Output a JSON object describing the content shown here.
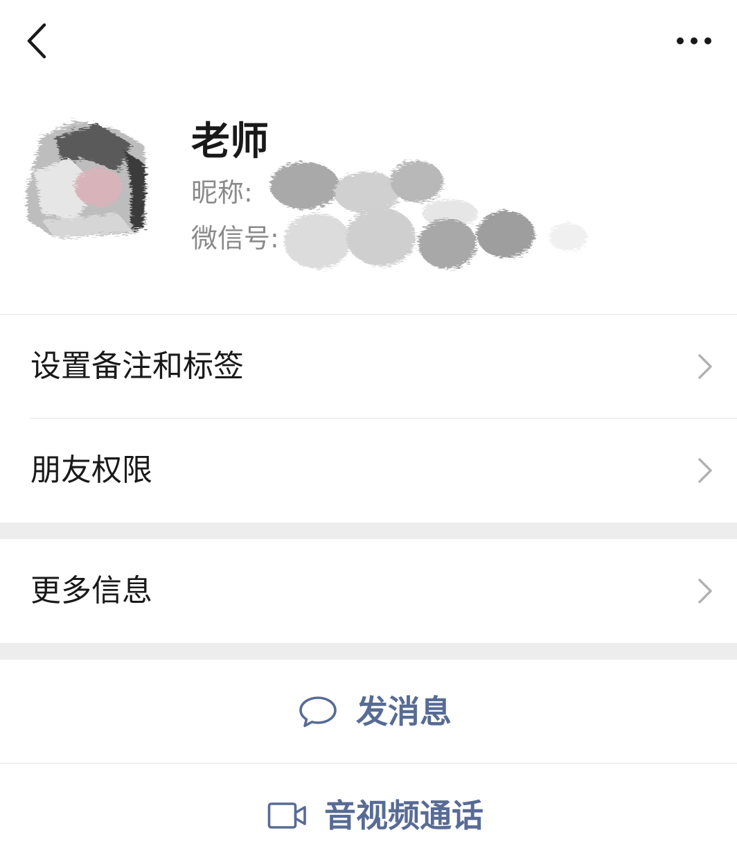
{
  "nav": {
    "back_icon": "chevron-left-icon",
    "more_icon": "more-dots-icon"
  },
  "profile": {
    "name": "老师",
    "nickname_label": "昵称:",
    "wechat_id_label": "微信号:"
  },
  "menu": {
    "items": [
      {
        "label": "设置备注和标签",
        "icon": "chevron-right-icon"
      },
      {
        "label": "朋友权限",
        "icon": "chevron-right-icon"
      },
      {
        "label": "更多信息",
        "icon": "chevron-right-icon"
      }
    ]
  },
  "actions": {
    "send_message": {
      "label": "发消息",
      "icon": "chat-bubble-icon"
    },
    "av_call": {
      "label": "音视频通话",
      "icon": "video-camera-icon"
    }
  },
  "colors": {
    "accent": "#576b95",
    "text_primary": "#191919",
    "text_secondary": "#8a8a8a",
    "section_gap": "#ededed",
    "divider": "#e5e5e5"
  }
}
